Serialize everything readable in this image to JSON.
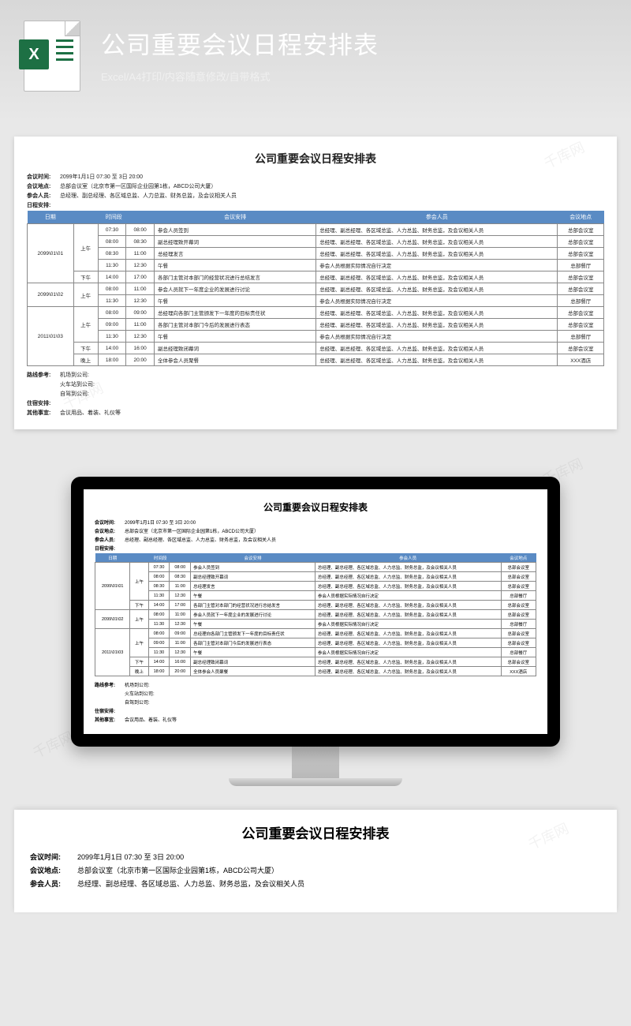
{
  "hero": {
    "title": "公司重要会议日程安排表",
    "subtitle": "Excel/A4打印/内容随意修改/自带格式"
  },
  "doc": {
    "title": "公司重要会议日程安排表",
    "meta": {
      "time_lbl": "会议时间:",
      "time_val": "2099年1月1日 07:30 至 3日 20:00",
      "place_lbl": "会议地点:",
      "place_val": "总部会议室（北京市第一区国际企业园第1栋，ABCD公司大厦）",
      "attend_lbl": "参会人员:",
      "attend_val": "总经理、副总经理、各区域总监、人力总监、财务总监，及会议相关人员",
      "sched_lbl": "日程安排:"
    },
    "headers": {
      "date": "日期",
      "period": "时间段",
      "agenda": "会议安排",
      "attendees": "参会人员",
      "location": "会议地点"
    },
    "full_attend": "总经理、副总经理、各区域总监、人力总监、财务总监，及会议相关人员",
    "self_lunch": "参会人员根据实际情况自行决定",
    "hq_room": "总部会议室",
    "hq_rest": "总部餐厅",
    "xxx_hotel": "XXX酒店",
    "days": [
      {
        "date": "2099\\01\\01",
        "blocks": [
          {
            "period": "上午",
            "rows": [
              {
                "s": "07:30",
                "e": "08:00",
                "a": "参会人员签到"
              },
              {
                "s": "08:00",
                "e": "08:30",
                "a": "副总经理致开幕词"
              },
              {
                "s": "08:30",
                "e": "11:00",
                "a": "总经理发言"
              },
              {
                "s": "11:30",
                "e": "12:30",
                "a": "午餐",
                "lunch": true
              }
            ]
          },
          {
            "period": "下午",
            "rows": [
              {
                "s": "14:00",
                "e": "17:00",
                "a": "各部门主管对本部门的经营状况进行总结发言"
              }
            ]
          }
        ]
      },
      {
        "date": "2099\\01\\02",
        "blocks": [
          {
            "period": "上午",
            "rows": [
              {
                "s": "08:00",
                "e": "11:00",
                "a": "参会人员就下一年度企业的发展进行讨论"
              },
              {
                "s": "11:30",
                "e": "12:30",
                "a": "午餐",
                "lunch": true
              }
            ]
          }
        ]
      },
      {
        "date": "2011\\01\\03",
        "blocks": [
          {
            "period": "上午",
            "rows": [
              {
                "s": "08:00",
                "e": "09:00",
                "a": "总经理向各部门主管颁发下一年度的目标责任状"
              },
              {
                "s": "09:00",
                "e": "11:00",
                "a": "各部门主管对本部门今后的发展进行表态"
              },
              {
                "s": "11:30",
                "e": "12:30",
                "a": "午餐",
                "lunch": true
              }
            ]
          },
          {
            "period": "下午",
            "rows": [
              {
                "s": "14:00",
                "e": "16:00",
                "a": "副总经理致闭幕词"
              }
            ]
          },
          {
            "period": "晚上",
            "rows": [
              {
                "s": "18:00",
                "e": "20:00",
                "a": "全体参会人员聚餐",
                "hotel": true
              }
            ]
          }
        ]
      }
    ],
    "footer": {
      "route_lbl": "路线参考:",
      "routes": [
        "机场到公司:",
        "火车站到公司:",
        "自驾到公司:"
      ],
      "stay_lbl": "住宿安排:",
      "other_lbl": "其他事宜:",
      "other_val": "会议用品、着装、礼仪等"
    }
  },
  "watermark": "千库网"
}
